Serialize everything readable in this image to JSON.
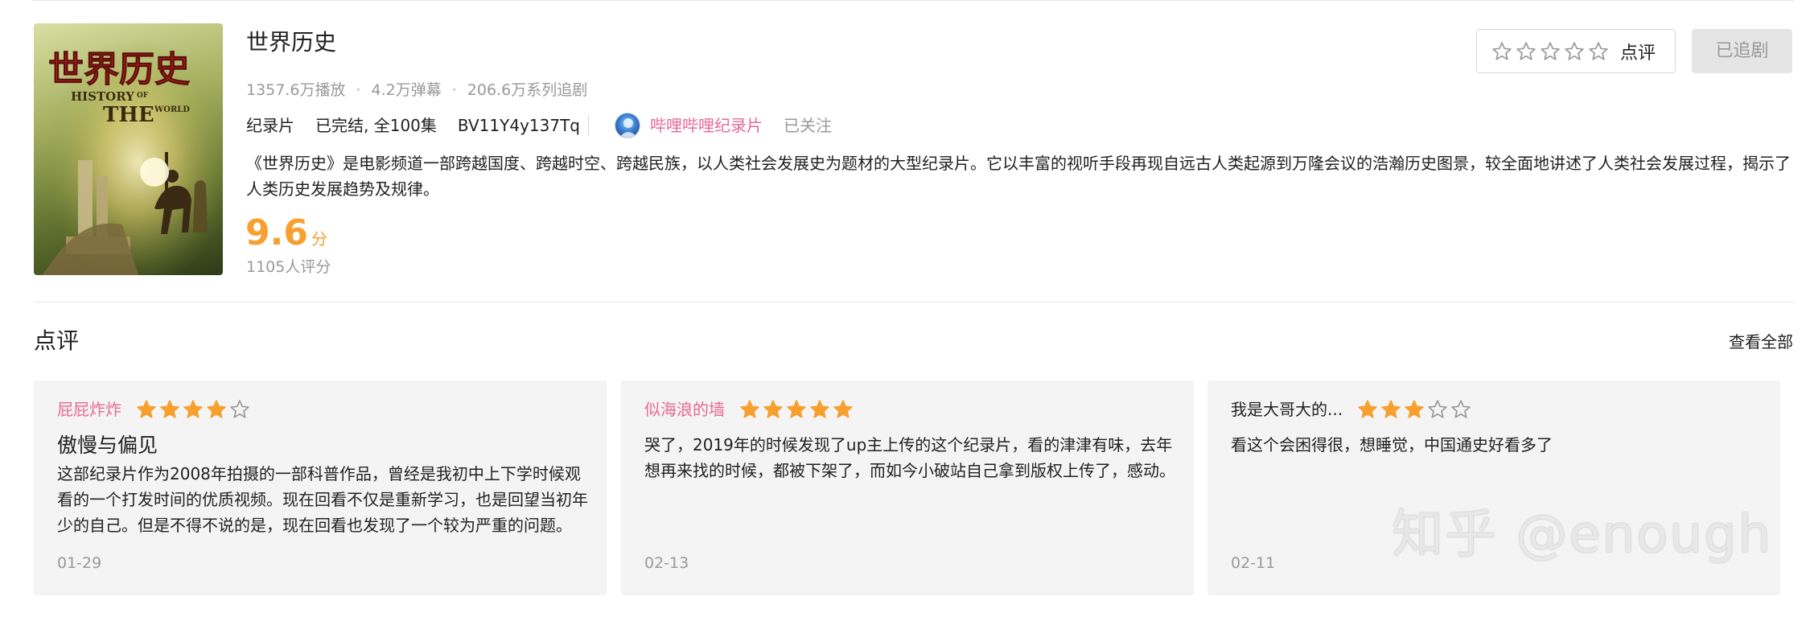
{
  "show": {
    "title": "世界历史",
    "poster_title_cn": "世界历史",
    "poster_title_en_1": "HISTORY",
    "poster_title_en_of": "OF",
    "poster_title_en_2": "THE",
    "poster_title_en_world": "WORLD",
    "stats": {
      "plays": "1357.6万播放",
      "danmaku": "4.2万弹幕",
      "followers": "206.6万系列追剧",
      "separator": "·"
    },
    "meta": {
      "type": "纪录片",
      "episodes": "已完结, 全100集",
      "bvid": "BV11Y4y137Tq",
      "up_name": "哔哩哔哩纪录片",
      "follow_state": "已关注"
    },
    "description": "《世界历史》是电影频道一部跨越国度、跨越时空、跨越民族，以人类社会发展史为题材的大型纪录片。它以丰富的视听手段再现自远古人类起源到万隆会议的浩瀚历史图景，较全面地讲述了人类社会发展过程，揭示了人类历史发展趋势及规律。",
    "score": "9.6",
    "score_unit": "分",
    "raters": "1105人评分",
    "rate_button_label": "点评",
    "follow_button_label": "已追剧"
  },
  "reviews": {
    "section_title": "点评",
    "view_all": "查看全部",
    "items": [
      {
        "user": "屁屁炸炸",
        "stars": 4,
        "title": "傲慢与偏见",
        "body": "这部纪录片作为2008年拍摄的一部科普作品，曾经是我初中上下学时候观看的一个打发时间的优质视频。现在回看不仅是重新学习，也是回望当初年少的自己。但是不得不说的是，现在回看也发现了一个较为严重的问题。",
        "date": "01-29"
      },
      {
        "user": "似海浪的墙",
        "stars": 5,
        "title": "",
        "body": "哭了，2019年的时候发现了up主上传的这个纪录片，看的津津有味，去年想再来找的时候，都被下架了，而如今小破站自己拿到版权上传了，感动。",
        "date": "02-13"
      },
      {
        "user": "我是大哥大的...",
        "stars": 3,
        "title": "",
        "body": "看这个会困得很，想睡觉，中国通史好看多了",
        "date": "02-11"
      }
    ]
  },
  "watermark": "知乎 @enough",
  "colors": {
    "accent_pink": "#e86895",
    "score_orange": "#f79f2f",
    "star_filled": "#f7a02f",
    "muted_gray": "#999999",
    "card_bg": "#f4f4f4"
  }
}
